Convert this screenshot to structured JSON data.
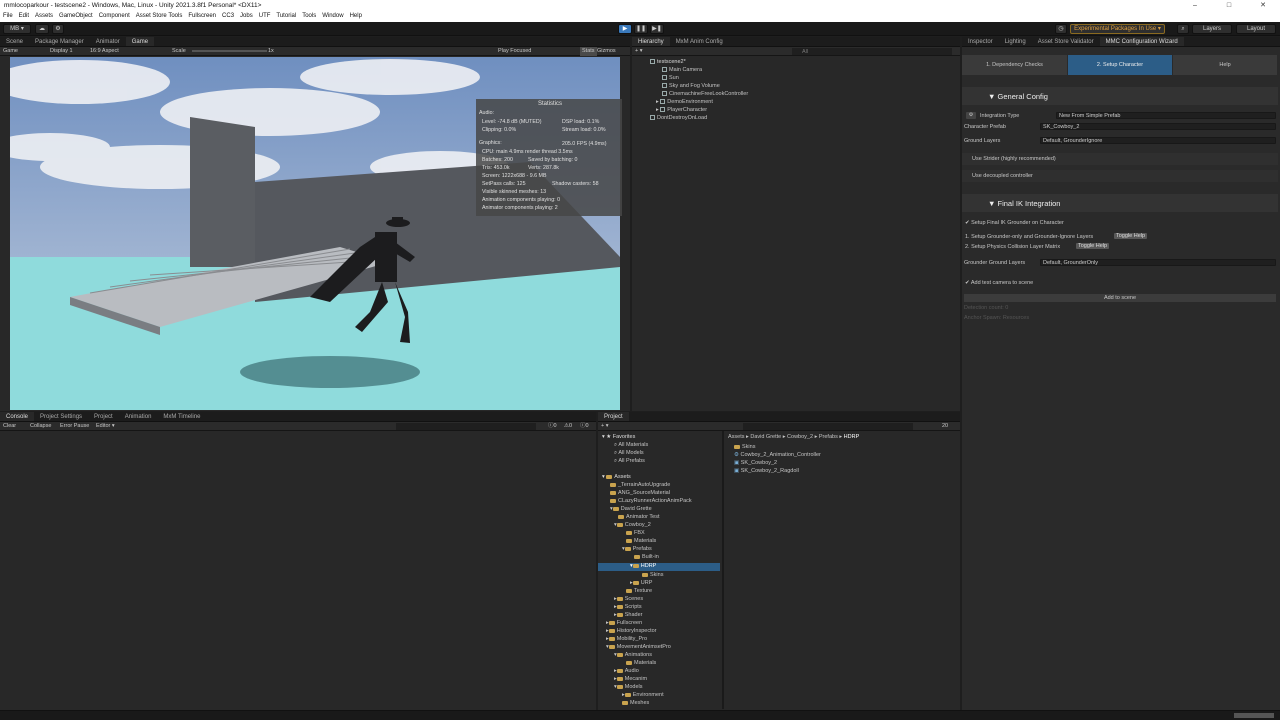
{
  "window": {
    "title": "mmlocoparkour - testscene2 - Windows, Mac, Linux - Unity 2021.3.8f1 Personal* <DX11>",
    "controls": [
      "–",
      "□",
      "✕"
    ]
  },
  "menu": [
    "File",
    "Edit",
    "Assets",
    "GameObject",
    "Component",
    "Asset Store Tools",
    "Fullscreen",
    "CC3",
    "Jobs",
    "UTF",
    "Tutorial",
    "Tools",
    "Window",
    "Help"
  ],
  "toolbar": {
    "account": "MB ▾",
    "experimental": "Experimental Packages In Use ▾",
    "layers": "Layers",
    "layout": "Layout"
  },
  "game_panel": {
    "tabs": [
      "Scene",
      "Package Manager",
      "Animator",
      "Game"
    ],
    "game_label": "Game",
    "display": "Display 1",
    "aspect": "16:9 Aspect",
    "scale_label": "Scale",
    "scale_value": "1x",
    "play_focused": "Play Focused",
    "stats_btn": "Stats",
    "gizmos": "Gizmos"
  },
  "stats": {
    "title": "Statistics",
    "audio": "Audio:",
    "level": "Level: -74.8 dB (MUTED)",
    "clipping": "Clipping: 0.0%",
    "dsp": "DSP load: 0.1%",
    "stream": "Stream load: 0.0%",
    "graphics": "Graphics:",
    "fps": "205.0 FPS (4.9ms)",
    "cpu": "CPU: main 4.9ms  render thread 3.5ms",
    "batches": "Batches: 200",
    "saved": "Saved by batching: 0",
    "tris": "Tris: 453.0k",
    "verts": "Verts: 287.8k",
    "screen": "Screen: 1222x688 - 9.6 MB",
    "setpass": "SetPass calls: 125",
    "shadow": "Shadow casters: 58",
    "skinned": "Visible skinned meshes: 13",
    "anim": "Animation components playing: 0",
    "animator": "Animator components playing: 2"
  },
  "hierarchy": {
    "tabs": [
      "Hierarchy",
      "MxM Anim Config"
    ],
    "search_placeholder": "All",
    "items": [
      "testscene2*",
      "Main Camera",
      "Sun",
      "Sky and Fog Volume",
      "CinemachineFreeLookController",
      "DemoEnvironment",
      "PlayerCharacter",
      "DontDestroyOnLoad"
    ]
  },
  "inspector": {
    "tabs": [
      "Inspector",
      "Lighting",
      "Asset Store Validator",
      "MMC Configuration Wizard"
    ],
    "wizard_tabs": [
      "1. Dependency Checks",
      "2. Setup Character",
      "Help"
    ],
    "general_config": "General Config",
    "integration_label": "Integration Type",
    "integration_value": "New From Simple Prefab",
    "char_prefab_label": "Character Prefab",
    "char_prefab_value": "SK_Cowboy_2",
    "ground_label": "Ground Layers",
    "ground_value": "Default, GrounderIgnore",
    "use_strider": "Use Strider (highly recommended)",
    "use_decoupled": "Use decoupled controller",
    "final_ik": "Final IK Integration",
    "setup_final_ik": "Setup Final IK Grounder on Character",
    "step1": "1. Setup Grounder-only and Grounder-Ignore Layers",
    "step2": "2. Setup Physics Collision Layer Matrix",
    "toggle_help": "Toggle Help",
    "grounder_label": "Grounder Ground Layers",
    "grounder_value": "Default, GrounderOnly",
    "add_camera": "Add test camera to scene",
    "add_to_scene": "Add to scene",
    "detection": "Detection count: 0",
    "anchor": "Anchor Spawn: Resources"
  },
  "console": {
    "tabs": [
      "Console",
      "Project Settings",
      "Project",
      "Animation",
      "MxM Timeline"
    ],
    "clear": "Clear",
    "collapse": "Collapse",
    "error_pause": "Error Pause",
    "editor": "Editor ▾",
    "counts": [
      "0",
      "0",
      "0"
    ]
  },
  "project": {
    "tab": "Project",
    "count": "20",
    "favorites": [
      "Favorites",
      "All Materials",
      "All Models",
      "All Prefabs"
    ],
    "tree": [
      "Assets",
      "_TerrainAutoUpgrade",
      "ANG_SourceMaterial",
      "CLazyRunnerActionAnimPack",
      "David Grette",
      "Animator Test",
      "Cowboy_2",
      "FBX",
      "Materials",
      "Prefabs",
      "Built-in",
      "HDRP",
      "Skins",
      "URP",
      "Texture",
      "Scenes",
      "Scripts",
      "Shader",
      "Fullscreen",
      "HistoryInspector",
      "Mobility_Pro",
      "MovementAnimsetPro",
      "Animations",
      "Materials",
      "Audio",
      "Mecanim",
      "Models",
      "Environment",
      "Meshes"
    ],
    "breadcrumb": [
      "Assets",
      "David Grette",
      "Cowboy_2",
      "Prefabs",
      "HDRP"
    ],
    "files": [
      "Skins",
      "Cowboy_2_Animation_Controller",
      "SK_Cowboy_2",
      "SK_Cowboy_2_Ragdoll"
    ]
  },
  "colors": {
    "accent": "#3a79bb",
    "selected": "#2c5d87",
    "sky": "#8fa6c8",
    "water": "#7fd6d6"
  }
}
